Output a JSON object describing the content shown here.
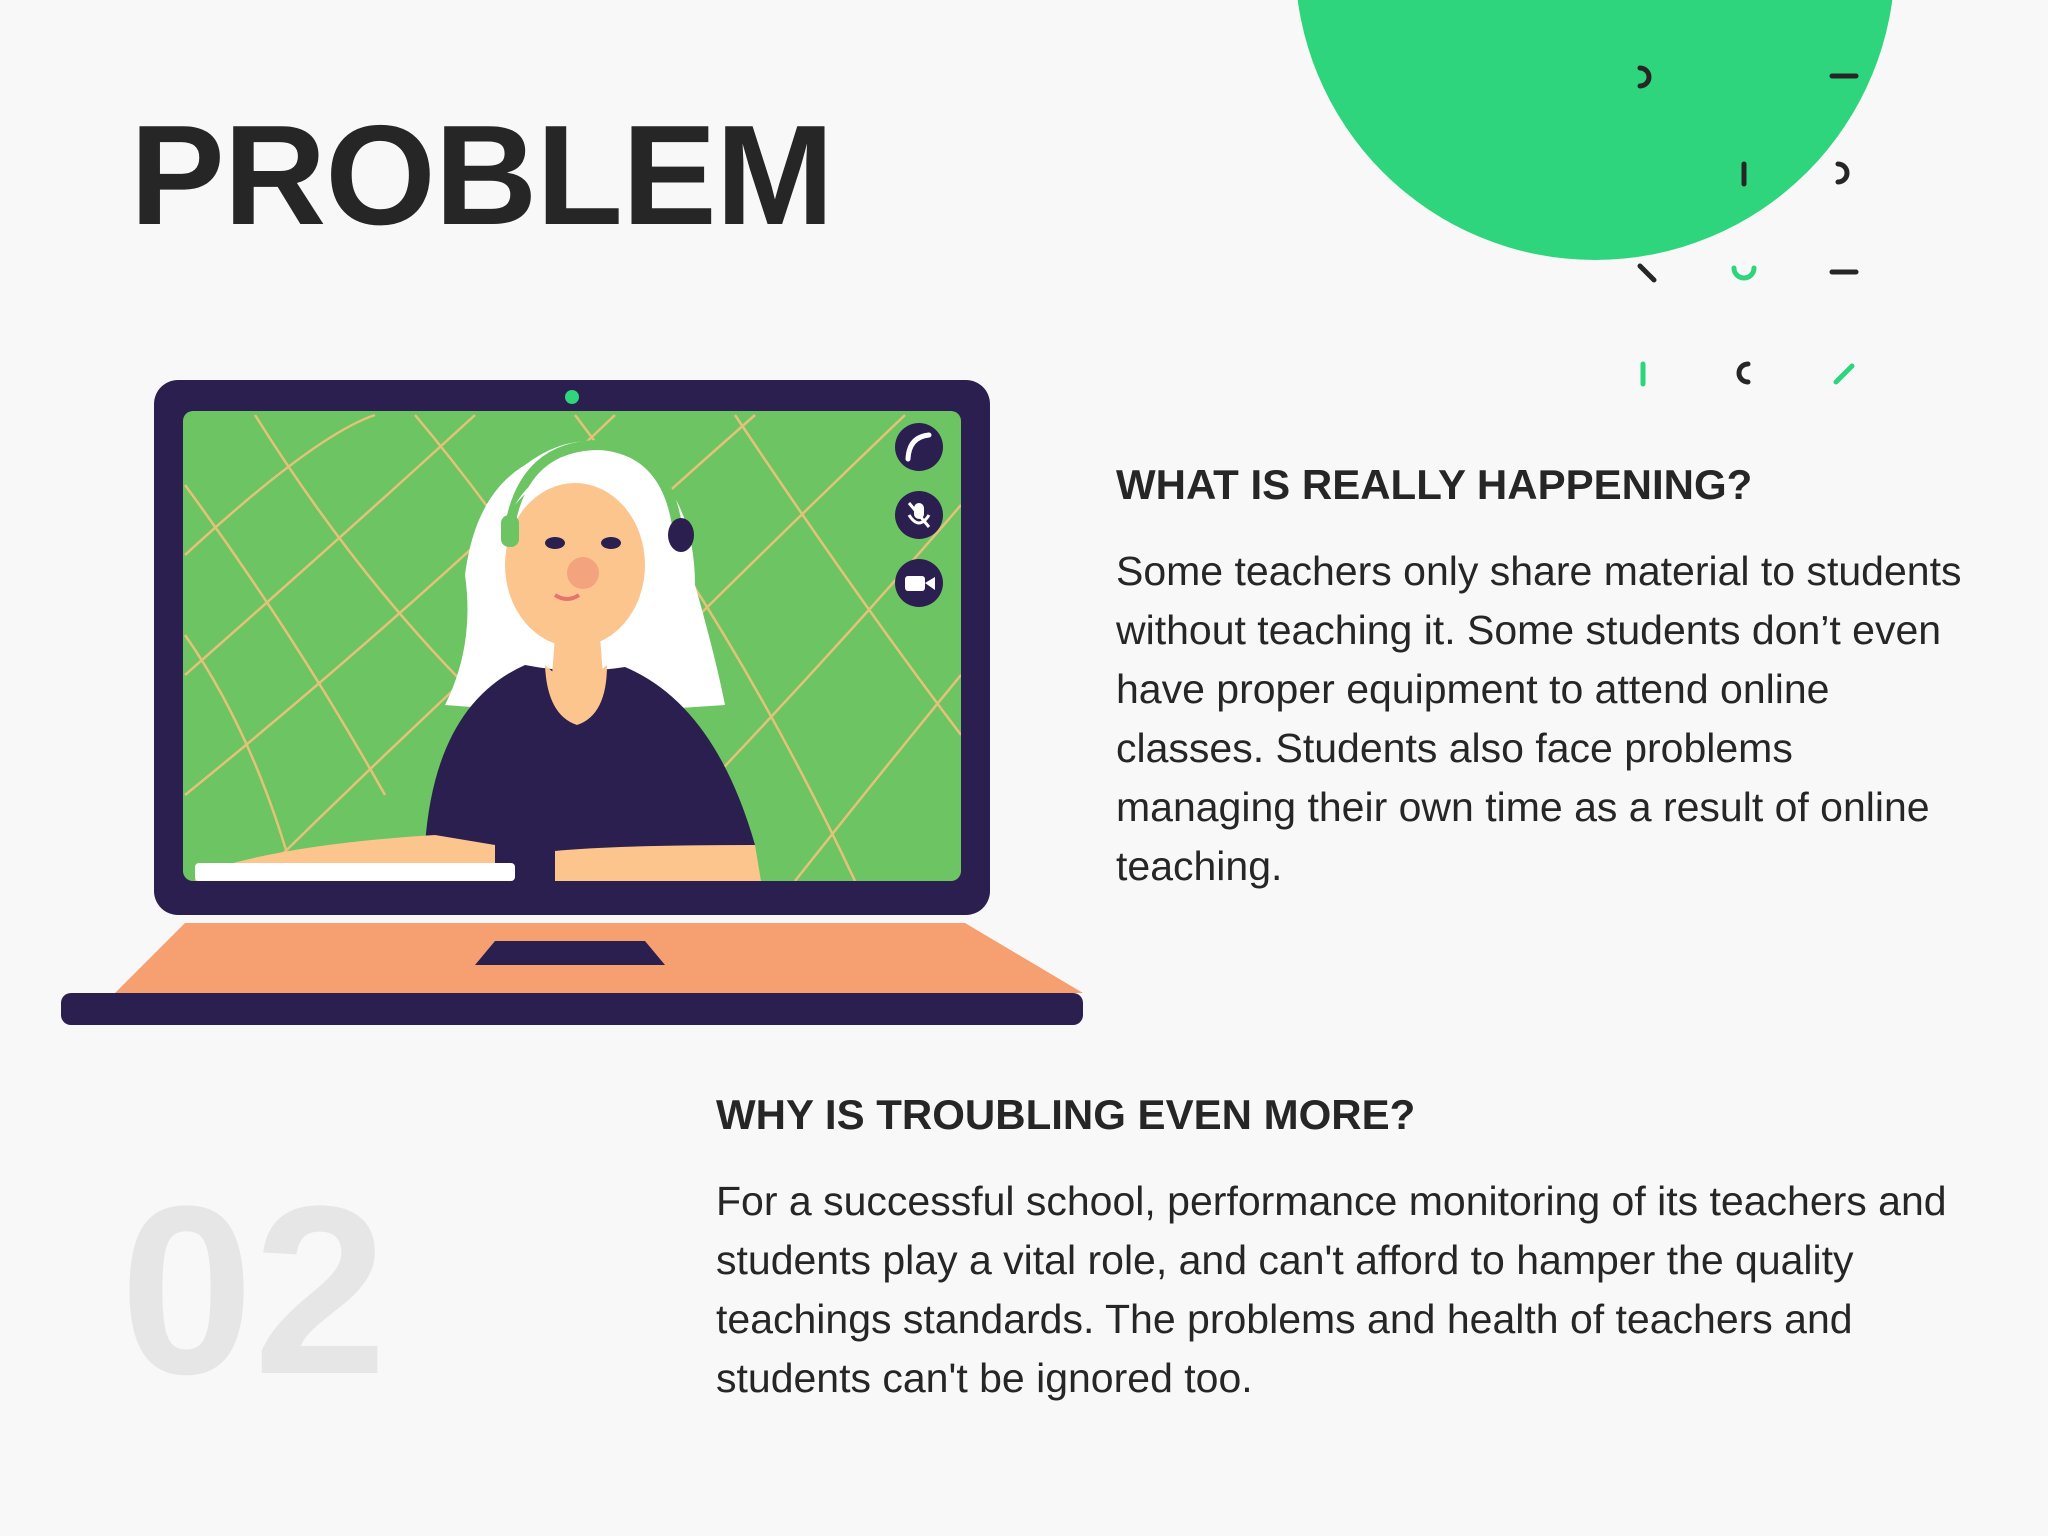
{
  "page": {
    "title": "PROBLEM",
    "number": "02"
  },
  "sections": [
    {
      "heading": "WHAT IS REALLY HAPPENING?",
      "body": "Some teachers only share material to students without teaching it. Some students don’t even have proper equipment to attend online classes. Students also face problems managing their own time as a result of online teaching."
    },
    {
      "heading": "WHY IS TROUBLING EVEN MORE?",
      "body": "For a successful school, performance monitoring of its teachers and students play a vital role, and can't afford to hamper the quality teachings standards. The problems and health of teachers and students can't be ignored too."
    }
  ],
  "colors": {
    "background": "#f8f8f8",
    "accent_green": "#2fd57d",
    "screen_green": "#6cc463",
    "laptop_navy": "#2b1f4f",
    "laptop_base": "#f6a072",
    "text_dark": "#262626",
    "number_gray": "#e6e6e6"
  },
  "illustration": {
    "icons": [
      "phone-icon",
      "mic-off-icon",
      "video-camera-icon"
    ]
  }
}
